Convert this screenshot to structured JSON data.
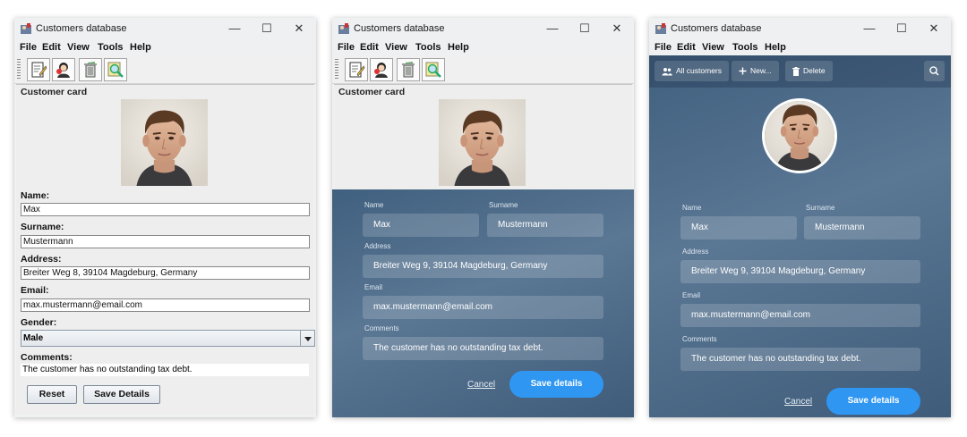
{
  "window": {
    "title": "Customers database"
  },
  "menu": [
    "File",
    "Edit",
    "View",
    "Tools",
    "Help"
  ],
  "card": {
    "section_title": "Customer card"
  },
  "labels": {
    "name": "Name:",
    "surname": "Surname:",
    "address": "Address:",
    "email": "Email:",
    "gender": "Gender:",
    "comments": "Comments:"
  },
  "modern_labels": {
    "name": "Name",
    "surname": "Surname",
    "address": "Address",
    "email": "Email",
    "comments": "Comments"
  },
  "customer": {
    "name": "Max",
    "surname": "Mustermann",
    "address_classic": "Breiter Weg 8, 39104 Magdeburg, Germany",
    "address_modern": "Breiter Weg 9, 39104 Magdeburg, Germany",
    "email": "max.mustermann@email.com",
    "gender": "Male",
    "comments": "The customer has no outstanding tax debt."
  },
  "buttons": {
    "reset": "Reset",
    "save_classic": "Save Details",
    "save_modern": "Save details",
    "cancel": "Cancel"
  },
  "actions": {
    "all_customers": "All customers",
    "new": "New...",
    "delete": "Delete"
  },
  "colors": {
    "accent": "#2f97f2",
    "modern_bg": "#4a6a8a",
    "classic_bg": "#eeeeee"
  },
  "icons": [
    "edit-document-icon",
    "customers-icon",
    "trash-icon",
    "search-icon",
    "people-icon",
    "plus-icon",
    "trash-icon"
  ]
}
